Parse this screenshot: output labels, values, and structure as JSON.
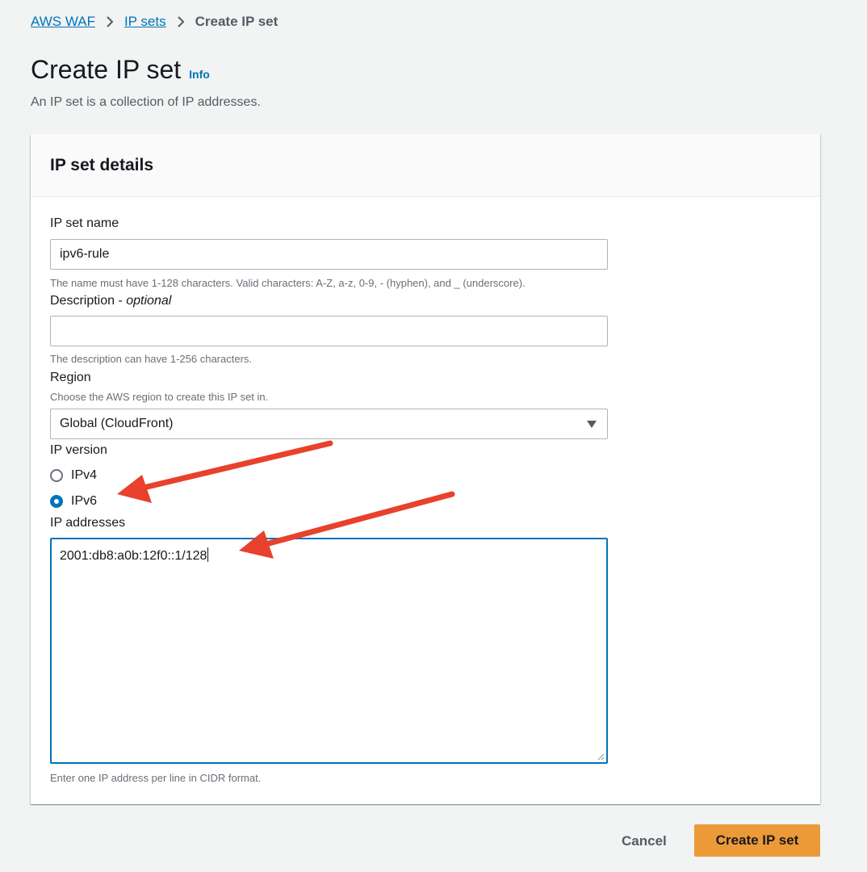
{
  "breadcrumb": {
    "items": [
      "AWS WAF",
      "IP sets"
    ],
    "current": "Create IP set"
  },
  "header": {
    "title": "Create IP set",
    "info_label": "Info",
    "description": "An IP set is a collection of IP addresses."
  },
  "panel": {
    "title": "IP set details",
    "name": {
      "label": "IP set name",
      "value": "ipv6-rule",
      "hint": "The name must have 1-128 characters. Valid characters: A-Z, a-z, 0-9, - (hyphen), and _ (underscore)."
    },
    "description": {
      "label": "Description - ",
      "label_optional": "optional",
      "value": "",
      "hint": "The description can have 1-256 characters."
    },
    "region": {
      "label": "Region",
      "hint": "Choose the AWS region to create this IP set in.",
      "value": "Global (CloudFront)"
    },
    "ip_version": {
      "label": "IP version",
      "options": [
        "IPv4",
        "IPv6"
      ],
      "selected": "IPv6"
    },
    "ip_addresses": {
      "label": "IP addresses",
      "value": "2001:db8:a0b:12f0::1/128",
      "hint": "Enter one IP address per line in CIDR format."
    }
  },
  "actions": {
    "cancel_label": "Cancel",
    "create_label": "Create IP set"
  },
  "colors": {
    "link": "#0073bb",
    "primary_button": "#ec9a37",
    "annotation_arrow": "#e8412c"
  }
}
